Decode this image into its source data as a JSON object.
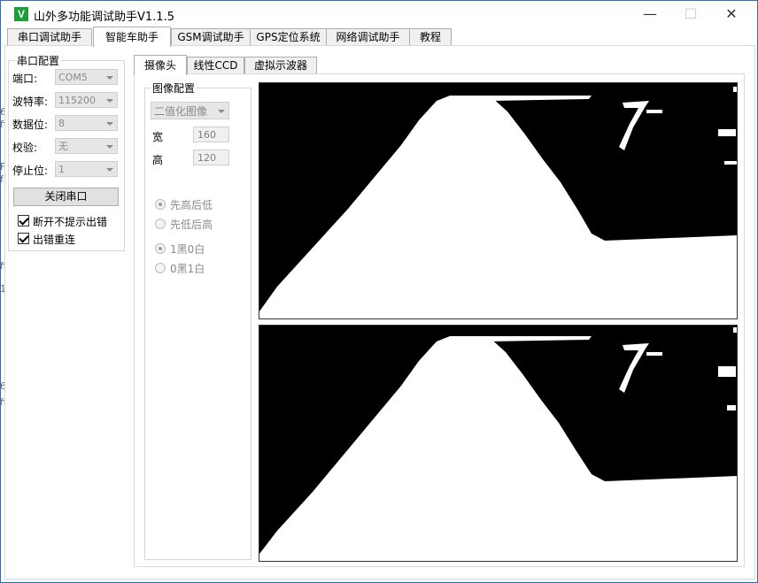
{
  "window": {
    "title": "山外多功能调试助手V1.1.5",
    "icon_letter": "V",
    "controls": {
      "minimize": "—",
      "maximize": "☐",
      "close": "✕"
    }
  },
  "tabs": [
    "串口调试助手",
    "智能车助手",
    "GSM调试助手",
    "GPS定位系统",
    "网络调试助手",
    "教程"
  ],
  "active_tab": "智能车助手",
  "serial": {
    "group_title": "串口配置",
    "port_label": "端口:",
    "port_value": "COM5",
    "baud_label": "波特率:",
    "baud_value": "115200",
    "databits_label": "数据位:",
    "databits_value": "8",
    "parity_label": "校验:",
    "parity_value": "无",
    "stopbits_label": "停止位:",
    "stopbits_value": "1",
    "close_button": "关闭串口",
    "no_prompt_label": "断开不提示出错",
    "no_prompt_checked": true,
    "reconnect_label": "出错重连",
    "reconnect_checked": true
  },
  "subtabs": [
    "摄像头",
    "线性CCD",
    "虚拟示波器"
  ],
  "active_subtab": "摄像头",
  "image_config": {
    "group_title": "图像配置",
    "mode_value": "二值化图像",
    "width_label": "宽",
    "width_value": "160",
    "height_label": "高",
    "height_value": "120",
    "order_options": [
      {
        "label": "先高后低",
        "selected": true
      },
      {
        "label": "先低后高",
        "selected": false
      }
    ],
    "color_options": [
      {
        "label": "1黑0白",
        "selected": true
      },
      {
        "label": "0黑1白",
        "selected": false
      }
    ]
  },
  "edge_fragments": [
    "6",
    "ff",
    "Fc",
    "f",
    "ff",
    "1",
    "6",
    "ff",
    "f",
    "ff"
  ],
  "colors": {
    "window_border": "#2b6fb6",
    "icon_green": "#1e9e3a",
    "image_black": "#000000",
    "image_white": "#ffffff"
  }
}
